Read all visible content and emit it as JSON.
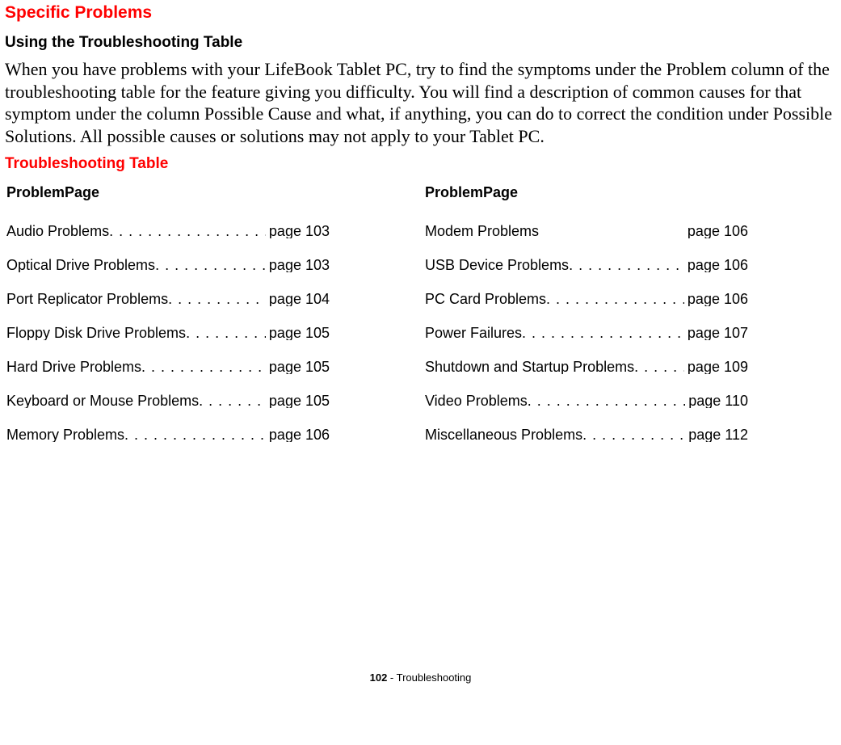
{
  "headings": {
    "specific_problems": "Specific Problems",
    "using_table": "Using the Troubleshooting Table",
    "troubleshooting_table": "Troubleshooting Table"
  },
  "body_paragraph": "When you have problems with your LifeBook Tablet PC, try to find the symptoms under the Problem column of the troubleshooting table for the feature giving you difficulty. You will find a description of common causes for that symptom under the column Possible Cause and what, if anything, you can do to correct the condition under Possible Solutions. All possible causes or solutions may not apply to your Tablet PC.",
  "col_headers": {
    "left": "ProblemPage",
    "right": "ProblemPage"
  },
  "left_items": [
    {
      "label": "Audio Problems ",
      "page": "page 103"
    },
    {
      "label": "Optical Drive Problems",
      "page": "page 103"
    },
    {
      "label": "Port Replicator Problems ",
      "page": "page 104"
    },
    {
      "label": "Floppy Disk Drive Problems",
      "page": "page 105"
    },
    {
      "label": "Hard Drive Problems ",
      "page": "page 105"
    },
    {
      "label": "Keyboard or Mouse Problems ",
      "page": "page 105"
    },
    {
      "label": "Memory Problems ",
      "page": "page 106"
    }
  ],
  "right_items": [
    {
      "label": "Modem Problems",
      "page": "page 106",
      "noleaders": true
    },
    {
      "label": "USB Device Problems",
      "page": "page 106"
    },
    {
      "label": "PC Card Problems",
      "page": "page 106"
    },
    {
      "label": "Power Failures",
      "page": "page 107"
    },
    {
      "label": "Shutdown and Startup Problems",
      "page": "page 109"
    },
    {
      "label": "Video Problems",
      "page": "page 110"
    },
    {
      "label": "Miscellaneous Problems ",
      "page": "page 112"
    }
  ],
  "footer": {
    "page_number": "102",
    "separator": " - ",
    "section": "Troubleshooting"
  }
}
